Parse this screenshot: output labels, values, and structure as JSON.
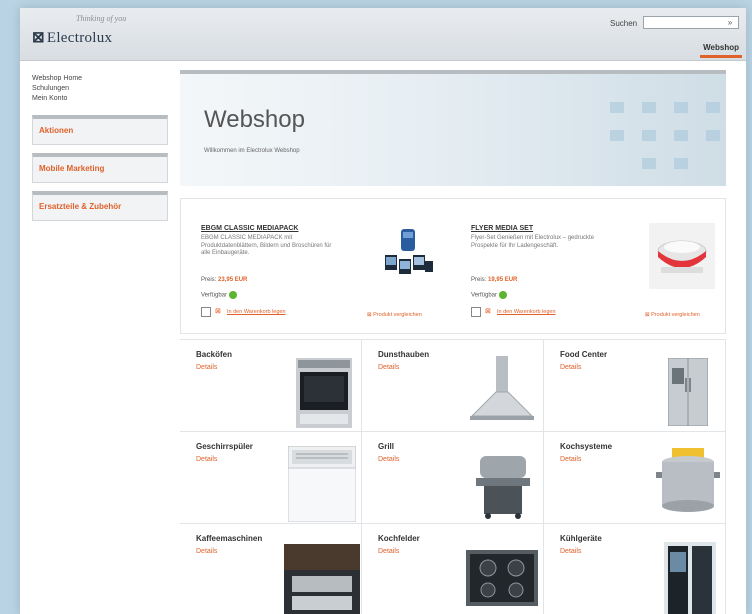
{
  "header": {
    "tagline": "Thinking of you",
    "logo": "Electrolux",
    "logo_mark": "⊠",
    "search_label": "Suchen",
    "search_value": "",
    "search_button": "»",
    "tab_webshop": "Webshop"
  },
  "sidebar": {
    "links": [
      "Webshop Home",
      "Schulungen",
      "Mein Konto"
    ],
    "boxes": [
      "Aktionen",
      "Mobile Marketing",
      "Ersatzteile & Zubehör"
    ]
  },
  "banner": {
    "title": "Webshop",
    "subtitle": "Willkommen im Electrolux Webshop"
  },
  "products": [
    {
      "name": "EBGM CLASSIC MEDIAPACK",
      "desc": "EBGM CLASSIC MEDIAPACK mit Produktdatenblättern, Bildern und Broschüren für alle Einbaugeräte.",
      "price_label": "Preis:",
      "price_value": "23,95 EUR",
      "avail_label": "Verfügbar",
      "cart_link": "In den Warenkorb legen",
      "compare": "Produkt vergleichen"
    },
    {
      "name": "FLYER MEDIA SET",
      "desc": "Flyer-Set Genießen mit Electrolux – gedruckte Prospekte für Ihr Ladengeschäft.",
      "price_label": "Preis:",
      "price_value": "19,95 EUR",
      "avail_label": "Verfügbar",
      "cart_link": "In den Warenkorb legen",
      "compare": "Produkt vergleichen"
    }
  ],
  "categories": [
    {
      "name": "Backöfen",
      "link": "Details"
    },
    {
      "name": "Dunsthauben",
      "link": "Details"
    },
    {
      "name": "Food Center",
      "link": "Details"
    },
    {
      "name": "Geschirrspüler",
      "link": "Details"
    },
    {
      "name": "Grill",
      "link": "Details"
    },
    {
      "name": "Kochsysteme",
      "link": "Details"
    },
    {
      "name": "Kaffeemaschinen",
      "link": "Details"
    },
    {
      "name": "Kochfelder",
      "link": "Details"
    },
    {
      "name": "Kühlgeräte",
      "link": "Details"
    }
  ],
  "colors": {
    "accent": "#e0612a",
    "page_bg": "#b9d3e4",
    "available": "#5bb531"
  }
}
